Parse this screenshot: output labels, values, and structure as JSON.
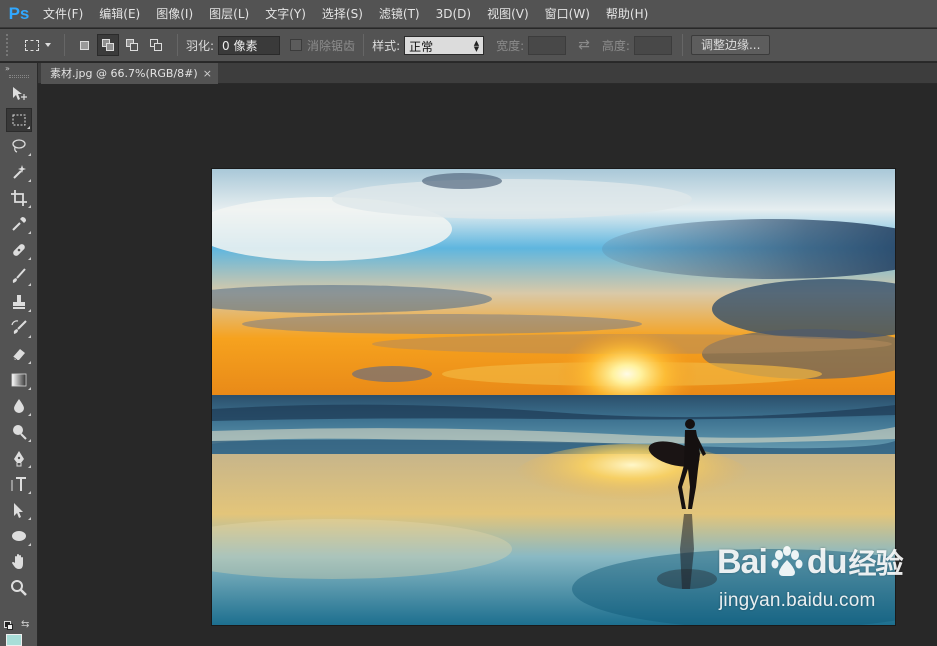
{
  "app": {
    "logo": "Ps",
    "menus": [
      "文件(F)",
      "编辑(E)",
      "图像(I)",
      "图层(L)",
      "文字(Y)",
      "选择(S)",
      "滤镜(T)",
      "3D(D)",
      "视图(V)",
      "窗口(W)",
      "帮助(H)"
    ]
  },
  "options": {
    "feather_label": "羽化:",
    "feather_value": "0 像素",
    "antialias_label": "消除锯齿",
    "style_label": "样式:",
    "style_value": "正常",
    "width_label": "宽度:",
    "height_label": "高度:",
    "refine_edge": "调整边缘..."
  },
  "document": {
    "tab_title": "素材.jpg @ 66.7%(RGB/8#)",
    "close_glyph": "×"
  },
  "toolbox": {
    "collapse_glyph": "»",
    "active_tool": "rectangular-marquee",
    "foreground_color": "#a8ded8",
    "tools": [
      "move",
      "rectangular-marquee",
      "lasso",
      "magic-wand",
      "crop",
      "eyedropper",
      "spot-healing",
      "brush",
      "clone-stamp",
      "history-brush",
      "eraser",
      "gradient",
      "blur",
      "dodge",
      "pen",
      "type",
      "path-selection",
      "ellipse",
      "hand",
      "zoom"
    ]
  },
  "watermark": {
    "brand": "Bai",
    "brand_tail": "du",
    "brand_cn": "经验",
    "url": "jingyan.baidu.com"
  },
  "colors": {
    "panel": "#535353",
    "workspace": "#282828",
    "ps_blue": "#31a8ff"
  }
}
